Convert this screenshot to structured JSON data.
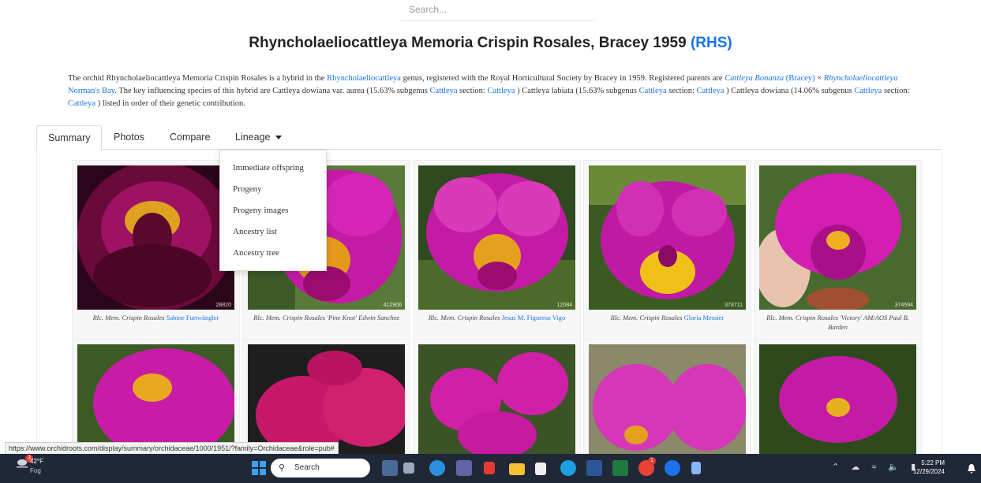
{
  "search": {
    "placeholder": "Search..."
  },
  "title": {
    "text": "Rhyncholaeliocattleya Memoria Crispin Rosales, Bracey 1959",
    "link": "(RHS)"
  },
  "description": {
    "p1": "The orchid Rhyncholaeliocattleya Memoria Crispin Rosales is a hybrid in the ",
    "genus_link": "Rhyncholaeliocattleya",
    "p2": " genus, registered with the Royal Horticultural Society by Bracey in 1959. Registered parents are ",
    "parent1": "Cattleya Bonanza",
    "parent1_reg": "(Bracey)",
    "times": " × ",
    "parent2": "Rhyncholaeliocattleya",
    "parent2_name": " Norman's Bay",
    "p3": ". The key influencing species of this hybrid are Cattleya dowiana var. aurea (15.63% subgenus ",
    "cattleya": "Cattleya",
    "section": " section: ",
    "close1": " ) Cattleya labiata (15.63% subgenus ",
    "close2": " ) Cattleya dowiana (14.06% subgenus ",
    "close3": " ) listed in order of their genetic contribution."
  },
  "tabs": [
    {
      "label": "Summary"
    },
    {
      "label": "Photos"
    },
    {
      "label": "Compare"
    },
    {
      "label": "Lineage"
    }
  ],
  "dropdown": [
    "Immediate offspring",
    "Progeny",
    "Progeny images",
    "Ancestry list",
    "Ancestry tree"
  ],
  "cards": [
    {
      "num": "28820",
      "cap_pre": "Rlc. Mem. Crispin Rosales ",
      "cap_link": "Sabine Furtwängler",
      "cap_post": ""
    },
    {
      "num": "412906",
      "cap_pre": "Rlc. Mem. Crispin Rosales 'Pine Knot' Edwin Sanchez",
      "cap_link": "",
      "cap_post": ""
    },
    {
      "num": "12084",
      "cap_pre": "Rlc. Mem. Crispin Rosales ",
      "cap_link": "Jesus M. Figueroa Vigo",
      "cap_post": ""
    },
    {
      "num": "378711",
      "cap_pre": "Rlc. Mem. Crispin Rosales ",
      "cap_link": "Gloria Messier",
      "cap_post": ""
    },
    {
      "num": "374594",
      "cap_pre": "Rlc. Mem. Crispin Rosales 'Victory' AM/AOS Paul B. Barden",
      "cap_link": "",
      "cap_post": ""
    }
  ],
  "status_url": "https://www.orchidroots.com/display/summary/orchidaceae/1000/1951/?family=Orchidaceae&role=pub#",
  "taskbar": {
    "temp": "42°F",
    "condition": "Fog",
    "search_label": "Search",
    "time": "5:22 PM",
    "date": "12/29/2024",
    "weather_badge": "3",
    "chrome_badge": "1"
  },
  "colors": {
    "link": "#1a73e8",
    "taskbar": "#202838",
    "flower_magenta": "#c2189a"
  }
}
